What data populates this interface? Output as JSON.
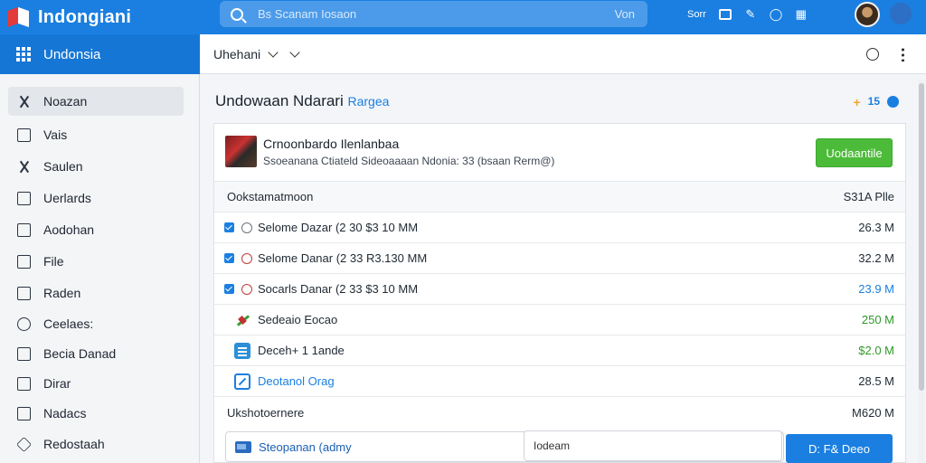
{
  "app": {
    "name": "Indongiani"
  },
  "search": {
    "text": "Bs Scanam Iosaon",
    "right_text": "Von"
  },
  "top_actions": {
    "label": "Sorr"
  },
  "nav": {
    "title": "Undonsia",
    "items": [
      {
        "label": "Noazan",
        "icon": "pin-icon",
        "active": true
      },
      {
        "label": "Vais",
        "icon": "list-icon"
      },
      {
        "label": "Saulen",
        "icon": "person-icon"
      },
      {
        "label": "Uerlards",
        "icon": "calendar-icon"
      },
      {
        "label": "Aodohan",
        "icon": "tag-icon"
      },
      {
        "label": "File",
        "icon": "file-icon"
      },
      {
        "label": "Raden",
        "icon": "folder-icon"
      },
      {
        "label": "Ceelaes:",
        "icon": "clipboard-icon"
      },
      {
        "label": "Becia Danad",
        "icon": "lock-icon"
      },
      {
        "label": "Dirar",
        "icon": "box-icon"
      },
      {
        "label": "Nadacs",
        "icon": "chart-icon"
      },
      {
        "label": "Redostaah",
        "icon": "diamond-icon"
      }
    ]
  },
  "header": {
    "title": "Uhehani"
  },
  "content": {
    "title": "Undowaan Ndarari",
    "title_accent": "Rargea",
    "action_count": "15"
  },
  "package": {
    "title": "Crnoonbardo Ilenlanbaa",
    "subtitle": "Ssoeanana Ctiateld Sideoaaaan Ndonia: 33 (bsaan Rerm@)",
    "button": "Uodaantile"
  },
  "table": {
    "header": {
      "label": "Ookstamatmoon",
      "value": "S31A Plle"
    },
    "rows": [
      {
        "label": "Selome Dazar (2 30 $3 10 MM",
        "value": "26.3 M",
        "kind": "check"
      },
      {
        "label": "Selome Danar (2 33 R3.130 MM",
        "value": "32.2 M",
        "kind": "check-red"
      },
      {
        "label": "Socarls Danar (2 33 $3 10 MM",
        "value": "23.9 M",
        "kind": "check-blue"
      },
      {
        "label": "Sedeaio Eocao",
        "value": "250 M",
        "kind": "pick"
      },
      {
        "label": "Deceh+ 1 1ande",
        "value": "$2.0 M",
        "kind": "doc"
      },
      {
        "label": "Deotanol Orag",
        "value": "28.5 M",
        "kind": "edit"
      }
    ],
    "footer": {
      "label": "Ukshotoernere",
      "value": "M620 M"
    }
  },
  "bottom": {
    "label": "Steopanan (admy",
    "input": "Iodeam",
    "button": "D:  F& Deeo"
  }
}
